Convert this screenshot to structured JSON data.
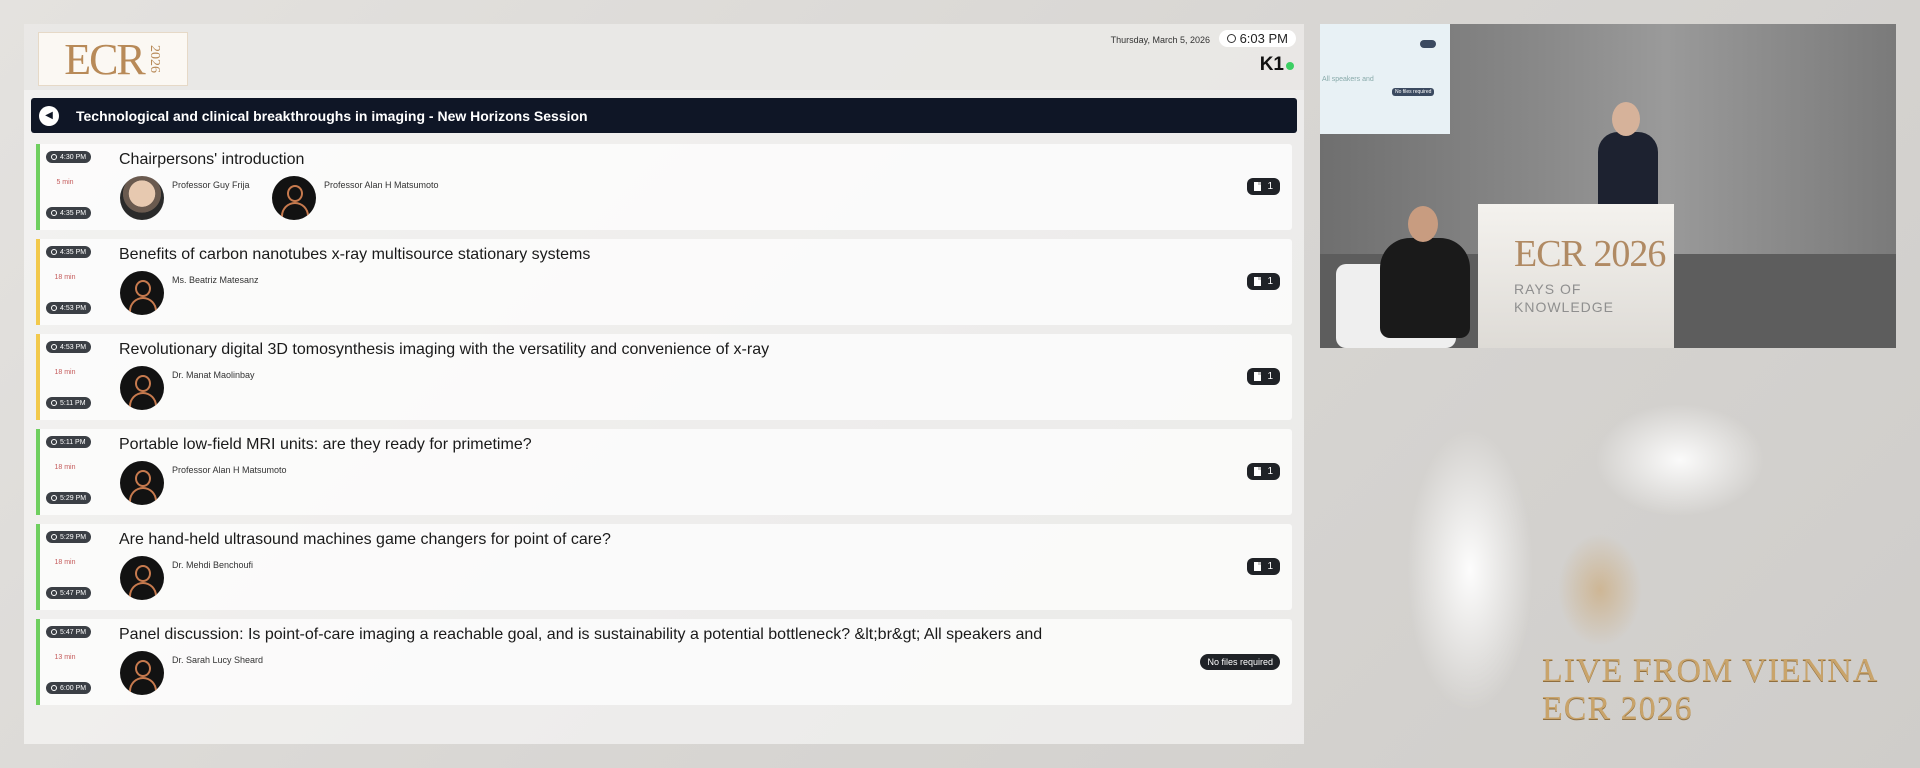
{
  "header": {
    "logo_text": "ECR",
    "logo_year": "2026",
    "date": "Thursday, March 5, 2026",
    "time": "6:03 PM",
    "room": "K1"
  },
  "session": {
    "title": "Technological and clinical breakthroughs in imaging - New Horizons Session"
  },
  "talks": [
    {
      "start": "4:30 PM",
      "duration": "5 min",
      "end": "4:35 PM",
      "title": "Chairpersons' introduction",
      "speakers": [
        "Professor Guy Frija",
        "Professor Alan H Matsumoto"
      ],
      "files": "1",
      "rail": "#6fcf5f"
    },
    {
      "start": "4:35 PM",
      "duration": "18 min",
      "end": "4:53 PM",
      "title": "Benefits of carbon nanotubes x-ray multisource stationary systems",
      "speakers": [
        "Ms. Beatriz Matesanz"
      ],
      "files": "1",
      "rail": "#f2c94c"
    },
    {
      "start": "4:53 PM",
      "duration": "18 min",
      "end": "5:11 PM",
      "title": "Revolutionary digital 3D tomosynthesis imaging with the versatility and convenience of x-ray",
      "speakers": [
        "Dr. Manat Maolinbay"
      ],
      "files": "1",
      "rail": "#f2c94c"
    },
    {
      "start": "5:11 PM",
      "duration": "18 min",
      "end": "5:29 PM",
      "title": "Portable low-field MRI units: are they ready for primetime?",
      "speakers": [
        "Professor Alan H Matsumoto"
      ],
      "files": "1",
      "rail": "#6fcf5f"
    },
    {
      "start": "5:29 PM",
      "duration": "18 min",
      "end": "5:47 PM",
      "title": "Are hand-held ultrasound machines game changers for point of care?",
      "speakers": [
        "Dr. Mehdi Benchoufi"
      ],
      "files": "1",
      "rail": "#6fcf5f"
    },
    {
      "start": "5:47 PM",
      "duration": "13 min",
      "end": "6:00 PM",
      "title": "Panel discussion: Is point-of-care imaging a reachable goal, and is sustainability a potential bottleneck? &lt;br&gt; All speakers and",
      "speakers": [
        "Dr. Sarah Lucy Sheard"
      ],
      "files_label": "No files required",
      "rail": "#6fcf5f"
    }
  ],
  "video": {
    "screen_text": "All speakers and",
    "screen_files": "No files required",
    "podium_brand": "ECR 2026",
    "podium_sub_1": "RAYS OF",
    "podium_sub_2": "KNOWLEDGE"
  },
  "branding": {
    "line1": "LIVE FROM VIENNA",
    "line2": "ECR 2026",
    "gold": "#c9a46b"
  },
  "colors": {
    "session_bar": "#0f1626",
    "badge": "#3b3f45",
    "status_dot": "#3ccf63"
  }
}
